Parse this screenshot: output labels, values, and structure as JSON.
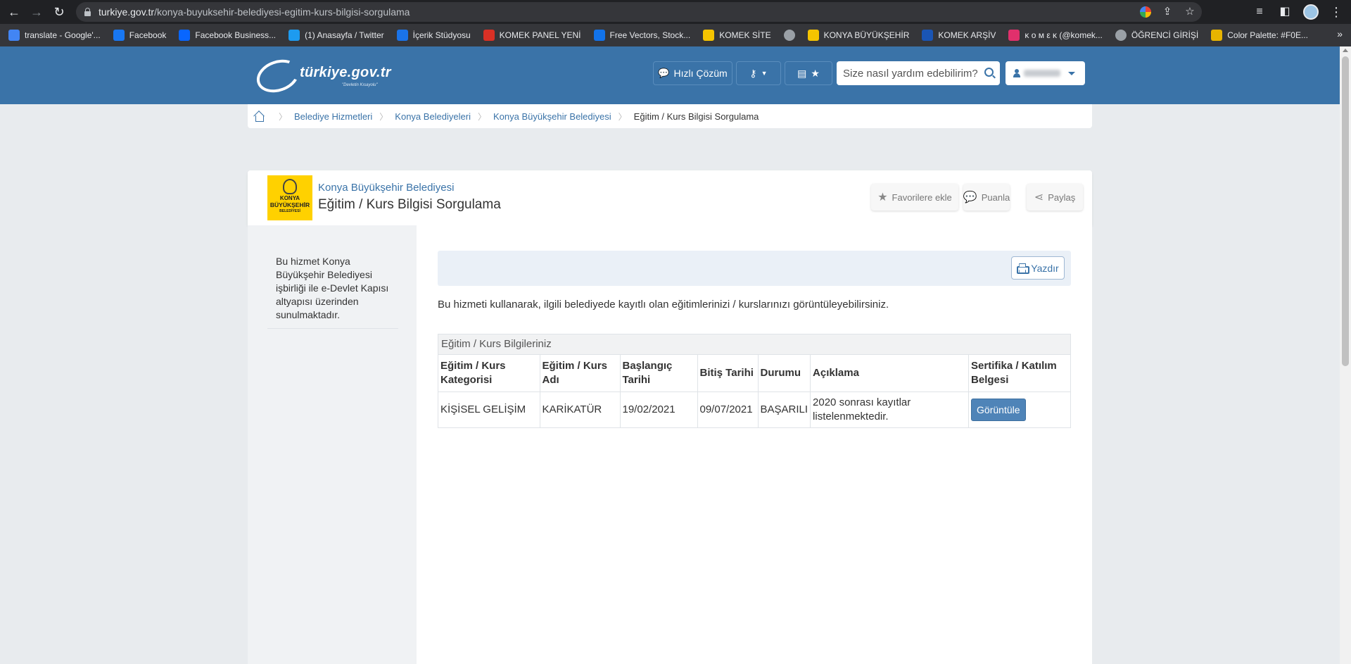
{
  "browser": {
    "url_host": "turkiye.gov.tr",
    "url_path": "/konya-buyuksehir-belediyesi-egitim-kurs-bilgisi-sorgulama",
    "bookmarks": [
      {
        "label": "translate - Google'...",
        "icon": "google-icon",
        "color": "#4285f4"
      },
      {
        "label": "Facebook",
        "icon": "facebook-icon",
        "color": "#1877f2"
      },
      {
        "label": "Facebook Business...",
        "icon": "meta-icon",
        "color": "#0866ff"
      },
      {
        "label": "(1) Anasayfa / Twitter",
        "icon": "twitter-icon",
        "color": "#1d9bf0"
      },
      {
        "label": "İçerik Stüdyosu",
        "icon": "studio-icon",
        "color": "#1a73e8"
      },
      {
        "label": "KOMEK PANEL YENİ",
        "icon": "star-icon",
        "color": "#d93025"
      },
      {
        "label": "Free Vectors, Stock...",
        "icon": "freepik-icon",
        "color": "#1273eb"
      },
      {
        "label": "KOMEK SİTE",
        "icon": "komek-icon",
        "color": "#f5c400"
      },
      {
        "label": "",
        "icon": "globe-icon",
        "color": "#9aa0a6"
      },
      {
        "label": "KONYA BÜYÜKŞEHİR",
        "icon": "konya-icon",
        "color": "#f5c400"
      },
      {
        "label": "KOMEK ARŞİV",
        "icon": "dsh-icon",
        "color": "#1a55b5"
      },
      {
        "label": "κ ο м ε κ (@komek...",
        "icon": "instagram-icon",
        "color": "#e1306c"
      },
      {
        "label": "ÖĞRENCİ GİRİŞİ",
        "icon": "globe-icon",
        "color": "#9aa0a6"
      },
      {
        "label": "Color Palette: #F0E...",
        "icon": "palette-icon",
        "color": "#e8b400"
      }
    ]
  },
  "header": {
    "logo_text": "türkiye.gov.tr",
    "logo_sub": "\"Devletin Kısayolu\"",
    "quick_solution": "Hızlı Çözüm",
    "search_placeholder": "Size nasıl yardım edebilirim?"
  },
  "breadcrumb": {
    "items": [
      "Belediye Hizmetleri",
      "Konya Belediyeleri",
      "Konya Büyükşehir Belediyesi"
    ],
    "current": "Eğitim / Kurs Bilgisi Sorgulama"
  },
  "page": {
    "logo_line1": "KONYA",
    "logo_line2": "BÜYÜKŞEHİR",
    "logo_line3": "BELEDİYESİ",
    "subtitle": "Konya Büyükşehir Belediyesi",
    "title": "Eğitim / Kurs Bilgisi Sorgulama",
    "actions": {
      "favorite": "Favorilere ekle",
      "rate": "Puanla",
      "share": "Paylaş"
    }
  },
  "sidebar": {
    "text": "Bu hizmet Konya Büyükşehir Belediyesi işbirliği ile e-Devlet Kapısı altyapısı üzerinden sunulmaktadır."
  },
  "content": {
    "print": "Yazdır",
    "intro": "Bu hizmeti kullanarak, ilgili belediyede kayıtlı olan eğitimlerinizi / kurslarınızı görüntüleyebilirsiniz.",
    "table": {
      "caption": "Eğitim / Kurs Bilgileriniz",
      "headers": [
        "Eğitim / Kurs Kategorisi",
        "Eğitim / Kurs Adı",
        "Başlangıç Tarihi",
        "Bitiş Tarihi",
        "Durumu",
        "Açıklama",
        "Sertifika / Katılım Belgesi"
      ],
      "rows": [
        {
          "category": "KİŞİSEL GELİŞİM",
          "name": "KARİKATÜR",
          "start": "19/02/2021",
          "end": "09/07/2021",
          "status": "BAŞARILI",
          "note": "2020 sonrası kayıtlar listelenmektedir.",
          "action": "Görüntüle"
        }
      ]
    }
  }
}
